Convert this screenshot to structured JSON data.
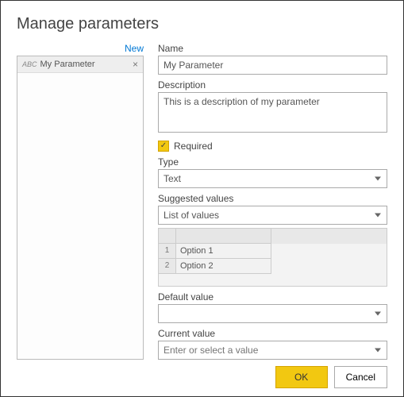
{
  "dialog": {
    "title": "Manage parameters"
  },
  "side": {
    "new_label": "New",
    "param_icon": "ABC",
    "param_name": "My Parameter",
    "close_glyph": "×"
  },
  "form": {
    "name_label": "Name",
    "name_value": "My Parameter",
    "desc_label": "Description",
    "desc_value": "This is a description of my parameter",
    "required_label": "Required",
    "required_check": "✓",
    "type_label": "Type",
    "type_value": "Text",
    "suggested_label": "Suggested values",
    "suggested_value": "List of values",
    "values": [
      {
        "n": "1",
        "v": "Option 1"
      },
      {
        "n": "2",
        "v": "Option 2"
      }
    ],
    "default_label": "Default value",
    "default_value": "",
    "current_label": "Current value",
    "current_placeholder": "Enter or select a value"
  },
  "buttons": {
    "ok": "OK",
    "cancel": "Cancel"
  }
}
